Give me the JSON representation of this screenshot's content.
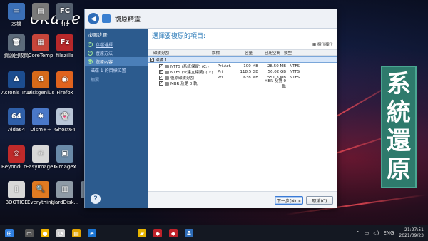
{
  "watermark": "okane",
  "desktop_icons": [
    {
      "label": "本機",
      "color": "#3b6fb6",
      "glyph": "▭"
    },
    {
      "label": "",
      "color": "#7a7a7a",
      "glyph": "▤"
    },
    {
      "label": "Ha",
      "color": "#55606e",
      "glyph": "FC"
    },
    {
      "label": "資源回收筒",
      "color": "#5d6b7a",
      "glyph": "🗑"
    },
    {
      "label": "CoreTemp",
      "color": "#c6453a",
      "glyph": "▦"
    },
    {
      "label": "filezilla",
      "color": "#b8282a",
      "glyph": "Fz"
    },
    {
      "label": "Acronis True Image 2018",
      "color": "#1c4d8f",
      "glyph": "A"
    },
    {
      "label": "Diskgenius",
      "color": "#d66a1a",
      "glyph": "G"
    },
    {
      "label": "Firefox",
      "color": "#e0631e",
      "glyph": "◉"
    },
    {
      "label": "Aida64",
      "color": "#2f5fa8",
      "glyph": "64"
    },
    {
      "label": "Dism++",
      "color": "#4a78c8",
      "glyph": "✱"
    },
    {
      "label": "Ghost64",
      "color": "#b9c6d8",
      "glyph": "👻"
    },
    {
      "label": "BeyondCo...",
      "color": "#c02a2a",
      "glyph": "◎"
    },
    {
      "label": "EasyImageX",
      "color": "#d8d8d8",
      "glyph": "☠"
    },
    {
      "label": "Gimagex",
      "color": "#6a8aa8",
      "glyph": "▣"
    },
    {
      "label": "BOOTICE",
      "color": "#d8d8d8",
      "glyph": "▯"
    },
    {
      "label": "Everything",
      "color": "#e07a22",
      "glyph": "🔍"
    },
    {
      "label": "HardDisk...",
      "color": "#8e9aa6",
      "glyph": "▥"
    },
    {
      "label": "PEN",
      "color": "#7f8fa0",
      "glyph": ""
    }
  ],
  "banner": [
    "系",
    "統",
    "還",
    "原"
  ],
  "dialog": {
    "title": "復原精靈",
    "sidebar": {
      "heading": "必要步驟:",
      "steps": [
        {
          "label": "存檔選擇",
          "active": false,
          "done": true
        },
        {
          "label": "復原方法",
          "active": false,
          "done": true
        },
        {
          "label": "復原內容",
          "active": true,
          "done": false
        }
      ],
      "subitems": [
        {
          "label": "磁碟 1 的目標位置",
          "link": true
        },
        {
          "label": "摘要",
          "link": false
        }
      ],
      "help": "?"
    },
    "content": {
      "heading": "選擇要復原的項目:",
      "toolbar": "欄位攔位",
      "columns": {
        "name": "磁碟分割",
        "flags": "旗標",
        "capacity": "容量",
        "used": "已用空間",
        "type": "類型"
      },
      "disk": {
        "label": "磁碟 1",
        "checked": true
      },
      "partitions": [
        {
          "name": "NTFS (系統保留) (C:)",
          "flags": "Pri,Act.",
          "capacity": "100 MB",
          "used": "28.50 MB",
          "type": "NTFS",
          "checked": true
        },
        {
          "name": "NTFS (未建立標籤) (D:)",
          "flags": "Pri",
          "capacity": "118.5 GB",
          "used": "56.02 GB",
          "type": "NTFS",
          "checked": true
        },
        {
          "name": "復原磁碟分割",
          "flags": "Pri",
          "capacity": "638 MB",
          "used": "551.3 MB",
          "type": "NTFS",
          "checked": true
        },
        {
          "name": "MBR 及第 0 軌",
          "flags": "",
          "capacity": "",
          "used": "MBR 及第 0 軌",
          "type": "",
          "checked": true
        }
      ],
      "next_label": "下一步(N) >",
      "cancel_label": "取消(C)"
    }
  },
  "taskbar": {
    "items": [
      {
        "name": "start",
        "color": "#2f7fe0",
        "glyph": "⊞"
      },
      {
        "name": "app-1",
        "color": "#555",
        "glyph": "▭"
      },
      {
        "name": "app-2",
        "color": "#f0b400",
        "glyph": "●"
      },
      {
        "name": "app-3",
        "color": "#d0d0d0",
        "glyph": "◔"
      },
      {
        "name": "app-4",
        "color": "#e2a400",
        "glyph": "▤"
      },
      {
        "name": "app-5",
        "color": "#1b74d2",
        "glyph": "e"
      },
      {
        "name": "app-6",
        "color": "#e7b400",
        "glyph": "▰"
      },
      {
        "name": "app-7",
        "color": "#c0222a",
        "glyph": "◆"
      },
      {
        "name": "app-8",
        "color": "#c0222a",
        "glyph": "◆"
      },
      {
        "name": "app-9",
        "color": "#2f6db8",
        "glyph": "A"
      }
    ],
    "language": "ENG",
    "time": "21:27:51",
    "date": "2021/09/23"
  },
  "colors": {
    "sidebar": "#2c5b8e",
    "accent": "#2a7ab8",
    "banner": "#2e7a6c"
  }
}
